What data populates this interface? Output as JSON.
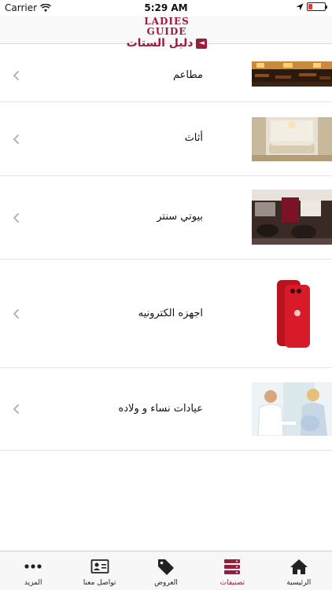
{
  "status_bar": {
    "carrier": "Carrier",
    "time": "5:29 AM",
    "battery_level": 0.25,
    "battery_color": "#e53935"
  },
  "header": {
    "logo_en": "LADIES GUIDE",
    "logo_ar": "دليل الستات"
  },
  "categories": [
    {
      "label": "مطاعم",
      "thumbnail": "restaurant-photo"
    },
    {
      "label": "أثاث",
      "thumbnail": "furniture-photo"
    },
    {
      "label": "بيوتي سنتر",
      "thumbnail": "beauty-salon-photo"
    },
    {
      "label": "اجهزه الكترونيه",
      "thumbnail": "red-phone-photo"
    },
    {
      "label": "عيادات نساء و ولاده",
      "thumbnail": "clinic-photo"
    }
  ],
  "tabbar": {
    "accent": "#9c1c3b",
    "items": [
      {
        "label": "الرئيسية",
        "icon": "home-icon"
      },
      {
        "label": "تصنيفات",
        "icon": "categories-icon",
        "active": true
      },
      {
        "label": "العروض",
        "icon": "tags-icon"
      },
      {
        "label": "تواصل معنا",
        "icon": "contact-card-icon"
      },
      {
        "label": "المزيد",
        "icon": "more-dots-icon"
      }
    ]
  }
}
